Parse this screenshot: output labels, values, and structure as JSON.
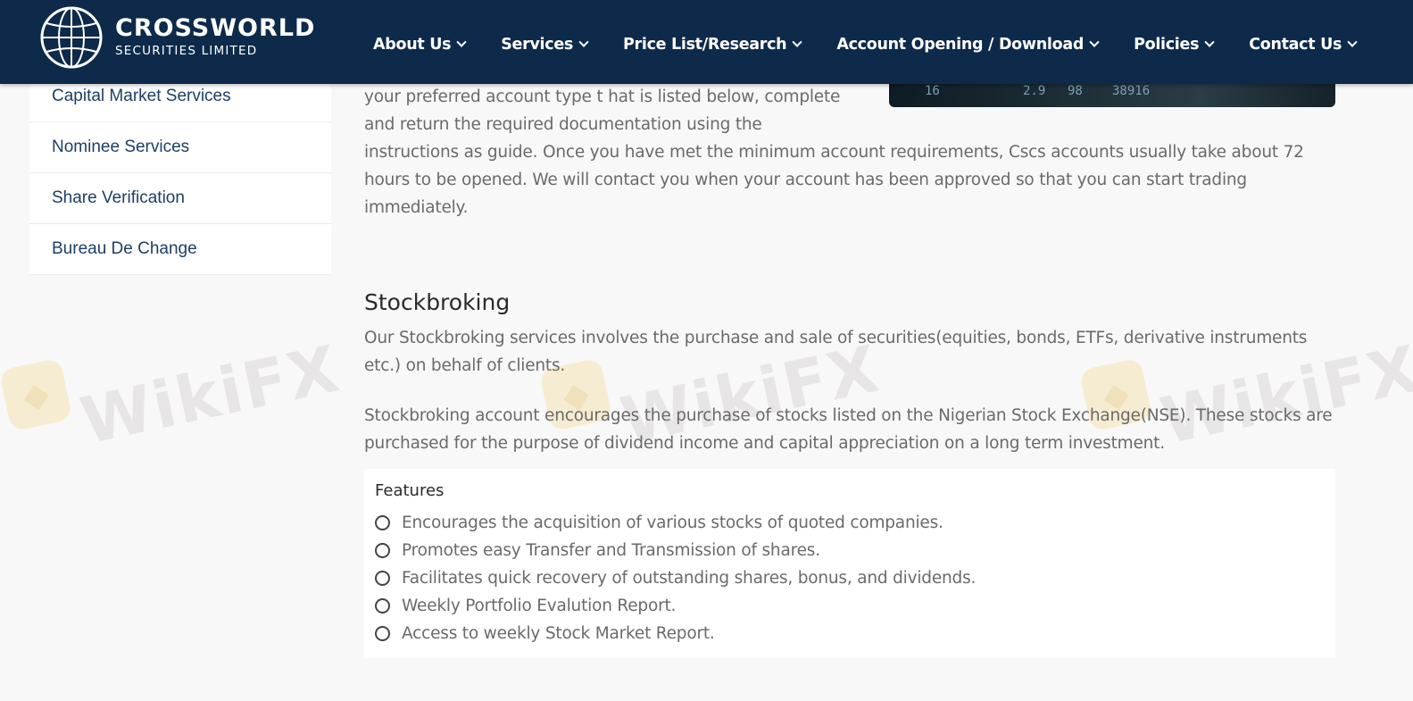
{
  "header": {
    "brand_name": "CROSSWORLD",
    "brand_sub": "SECURITIES LIMITED",
    "nav": [
      {
        "label": "About Us"
      },
      {
        "label": "Services"
      },
      {
        "label": "Price List/Research"
      },
      {
        "label": "Account Opening / Download"
      },
      {
        "label": "Policies"
      },
      {
        "label": "Contact Us"
      }
    ]
  },
  "sidebar": {
    "items": [
      {
        "label": "Capital Market Services"
      },
      {
        "label": "Nominee Services"
      },
      {
        "label": "Share Verification"
      },
      {
        "label": "Bureau De Change"
      }
    ]
  },
  "main": {
    "intro_line1": "your preferred account type t hat is listed below, complete and return the required documentation using the",
    "intro_line2": "instructions as guide. Once you have met the minimum account requirements, Cscs accounts usually take about 72 hours to be opened. We will contact you when your account has been approved so that you can start trading immediately.",
    "heading": "Stockbroking",
    "para1": "Our Stockbroking services involves the purchase and sale of securities(equities, bonds, ETFs, derivative instruments etc.) on behalf of clients.",
    "para2": "Stockbroking account encourages the purchase of stocks listed on the Nigerian Stock Exchange(NSE). These stocks are purchased for the purpose of dividend income and capital appreciation on a long term investment.",
    "features_title": "Features",
    "features": [
      "Encourages the acquisition of various stocks of quoted companies.",
      "Promotes easy Transfer and Transmission of shares.",
      "Facilitates quick recovery of outstanding shares, bonus, and dividends.",
      "Weekly Portfolio Evalution Report.",
      "Access to weekly Stock Market Report."
    ]
  },
  "watermark": {
    "text": "WikiFX"
  }
}
